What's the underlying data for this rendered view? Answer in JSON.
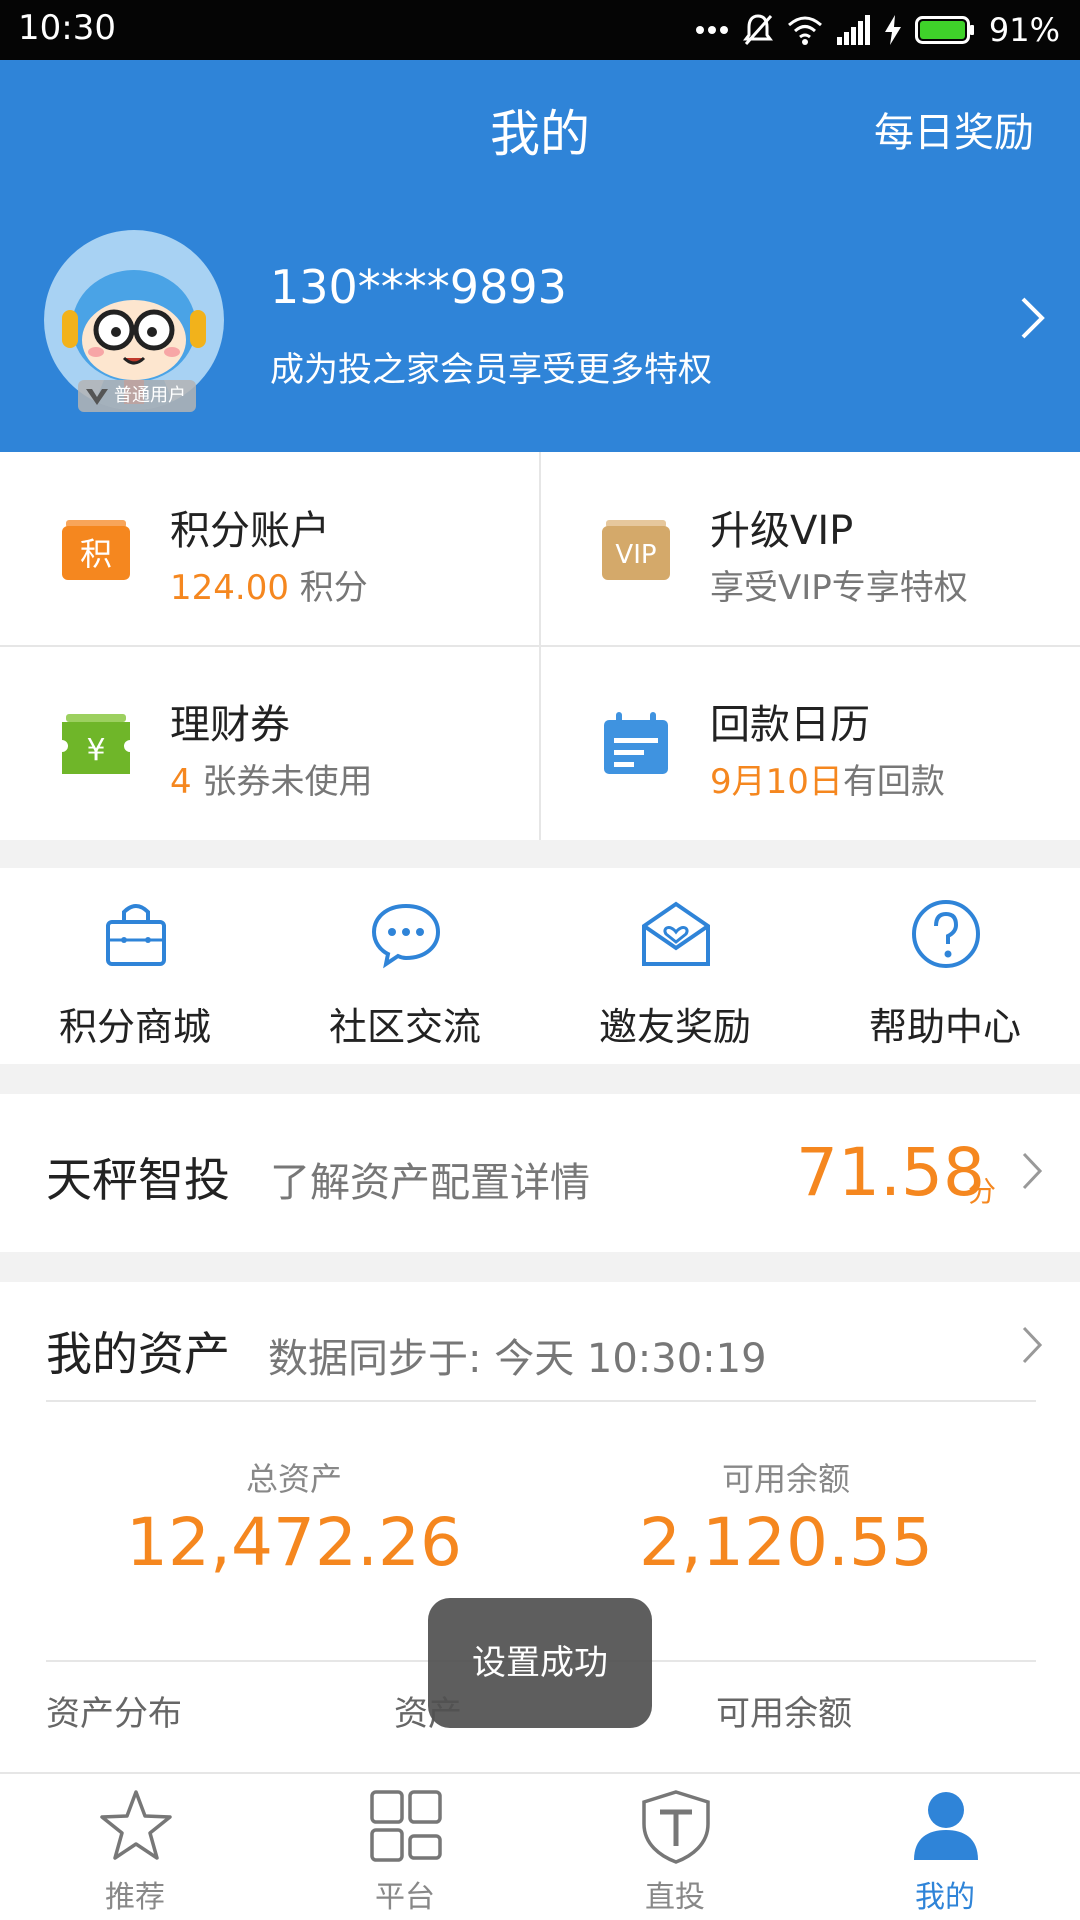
{
  "status_bar": {
    "time": "10:30",
    "battery": "91%"
  },
  "header": {
    "title": "我的",
    "daily_reward": "每日奖励",
    "phone": "130****9893",
    "member_promo": "成为投之家会员享受更多特权",
    "badge": "普通用户"
  },
  "grid": {
    "points": {
      "title": "积分账户",
      "value": "124.00",
      "suffix": "积分",
      "icon_text": "积"
    },
    "vip": {
      "title": "升级VIP",
      "subtitle": "享受VIP专享特权",
      "icon_text": "VIP"
    },
    "coupons": {
      "title": "理财券",
      "value": "4",
      "suffix": "张券未使用",
      "icon_text": "¥"
    },
    "calendar": {
      "title": "回款日历",
      "value": "9月10日",
      "suffix": "有回款"
    }
  },
  "quick_links": [
    {
      "label": "积分商城",
      "icon": "shopping-bag-icon"
    },
    {
      "label": "社区交流",
      "icon": "chat-bubble-icon"
    },
    {
      "label": "邀友奖励",
      "icon": "envelope-heart-icon"
    },
    {
      "label": "帮助中心",
      "icon": "help-icon"
    }
  ],
  "smart_invest": {
    "name": "天秤智投",
    "desc": "了解资产配置详情",
    "score": "71.58",
    "unit": "分"
  },
  "assets": {
    "name": "我的资产",
    "sync": "数据同步于: 今天 10:30:19",
    "total_label": "总资产",
    "total_value": "12,472.26",
    "available_label": "可用余额",
    "available_value": "2,120.55",
    "col1": "资产分布",
    "col2": "资产",
    "col3": "可用余额"
  },
  "toast": "设置成功",
  "nav": [
    {
      "label": "推荐",
      "icon": "star-icon"
    },
    {
      "label": "平台",
      "icon": "grid-icon"
    },
    {
      "label": "直投",
      "icon": "shield-icon"
    },
    {
      "label": "我的",
      "icon": "user-icon",
      "active": true
    }
  ],
  "colors": {
    "brand_blue": "#2f84d8",
    "accent_orange": "#f5871f",
    "coupon_green": "#6fb629",
    "vip_gold": "#d4a96a"
  }
}
